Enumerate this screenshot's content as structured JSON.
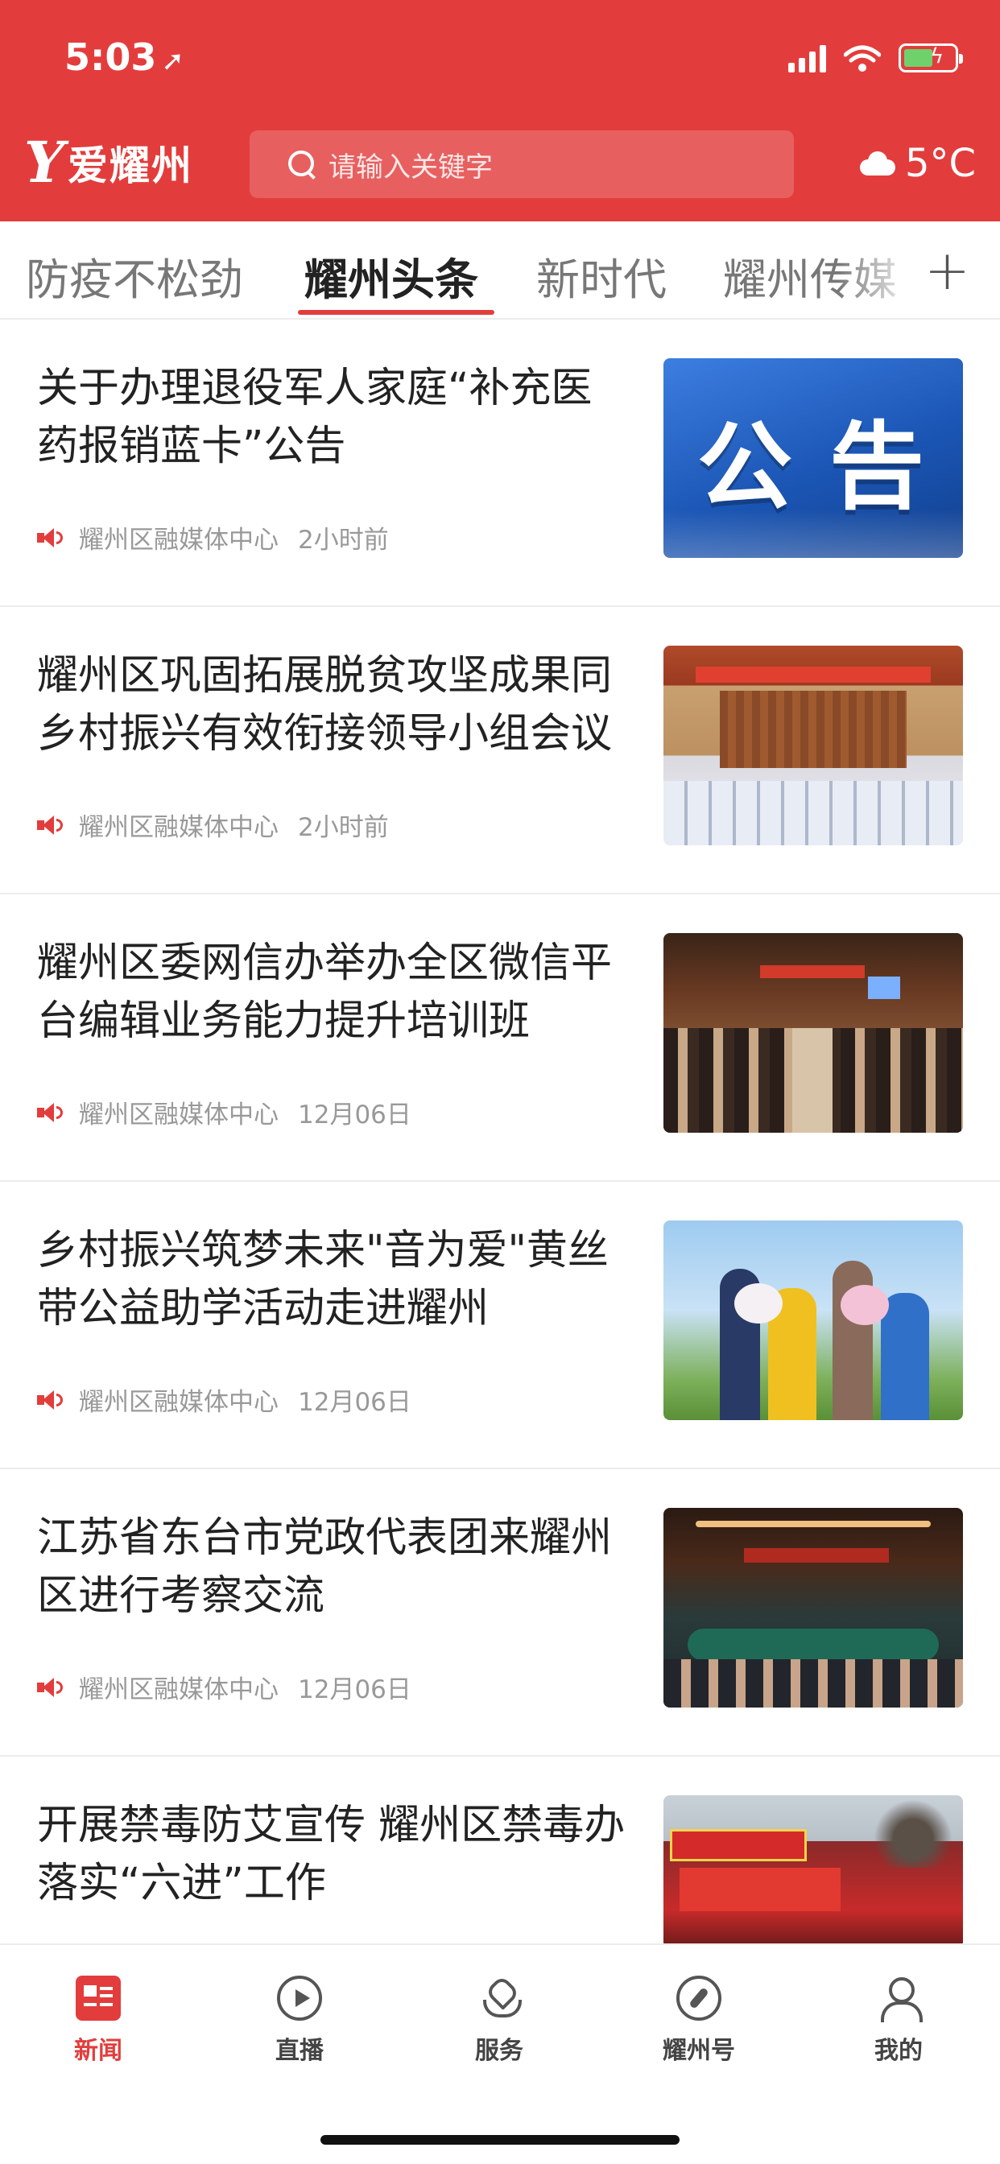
{
  "status_bar": {
    "time": "5:03",
    "location_arrow": "location-arrow-icon"
  },
  "header": {
    "logo_mark": "Y",
    "logo_text": "爱耀州",
    "search_placeholder": "请输入关键字",
    "weather_icon": "cloud-icon",
    "temperature": "5°C"
  },
  "tabs": [
    {
      "label": "防疫不松劲"
    },
    {
      "label": "耀州头条"
    },
    {
      "label": "新时代"
    },
    {
      "label": "耀州传媒"
    }
  ],
  "active_tab": "耀州头条",
  "news": [
    {
      "title": "关于办理退役军人家庭“补充医药报销蓝卡”公告",
      "source": "耀州区融媒体中心",
      "time": "2小时前",
      "thumb_text": "公告"
    },
    {
      "title": "耀州区巩固拓展脱贫攻坚成果同乡村振兴有效衔接领导小组会议",
      "source": "耀州区融媒体中心",
      "time": "2小时前"
    },
    {
      "title": "耀州区委网信办举办全区微信平台编辑业务能力提升培训班",
      "source": "耀州区融媒体中心",
      "time": "12月06日"
    },
    {
      "title": "乡村振兴筑梦未来\"音为爱\"黄丝带公益助学活动走进耀州",
      "source": "耀州区融媒体中心",
      "time": "12月06日"
    },
    {
      "title": "江苏省东台市党政代表团来耀州区进行考察交流",
      "source": "耀州区融媒体中心",
      "time": "12月06日"
    },
    {
      "title": "开展禁毒防艾宣传 耀州区禁毒办落实“六进”工作",
      "source": "",
      "time": ""
    }
  ],
  "bottom_nav": [
    {
      "label": "新闻",
      "icon": "news-icon",
      "active": true
    },
    {
      "label": "直播",
      "icon": "play-icon"
    },
    {
      "label": "服务",
      "icon": "service-icon"
    },
    {
      "label": "耀州号",
      "icon": "compass-icon"
    },
    {
      "label": "我的",
      "icon": "user-icon"
    }
  ],
  "colors": {
    "brand_red": "#e23d3c",
    "battery_green": "#6fd16b"
  }
}
